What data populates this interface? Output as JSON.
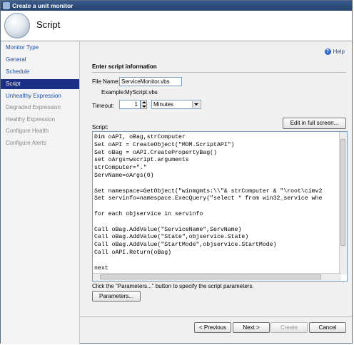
{
  "window": {
    "title": "Create a unit monitor"
  },
  "header": {
    "heading": "Script"
  },
  "sidebar": {
    "items": [
      {
        "label": "Monitor Type",
        "state": "link"
      },
      {
        "label": "General",
        "state": "link"
      },
      {
        "label": "Schedule",
        "state": "link"
      },
      {
        "label": "Script",
        "state": "selected"
      },
      {
        "label": "Unhealthy Expression",
        "state": "link"
      },
      {
        "label": "Degraded Expression",
        "state": "disabled"
      },
      {
        "label": "Healthy Expression",
        "state": "disabled"
      },
      {
        "label": "Configure Health",
        "state": "disabled"
      },
      {
        "label": "Configure Alerts",
        "state": "disabled"
      }
    ]
  },
  "main": {
    "help_label": "Help",
    "section_title": "Enter script information",
    "file_name_label": "File Name:",
    "file_name_value": "ServiceMonitor.vbs",
    "example_label": "Example:",
    "example_value": "MyScript.vbs",
    "timeout_label": "Timeout:",
    "timeout_value": "1",
    "timeout_unit": "Minutes",
    "script_label": "Script:",
    "edit_full_screen": "Edit in full screen...",
    "script_text": "Dim oAPI, oBag,strComputer\nSet oAPI = CreateObject(\"MOM.ScriptAPI\")\nSet oBag = oAPI.CreatePropertyBag()\nset oArgs=wscript.arguments\nstrComputer=\".\"\nServName=oArgs(0)\n\nSet namespace=GetObject(\"winmgmts:\\\\\"& strComputer & \"\\root\\cimv2\nSet servinfo=namespace.ExecQuery(\"select * from win32_service whe\n\nfor each objservice in servinfo\n\nCall oBag.AddValue(\"ServiceName\",ServName)\nCall oBag.AddValue(\"State\",objservice.State)\nCall oBag.AddValue(\"StartMode\",objservice.StartMode)\nCall oAPI.Return(oBag)\n\nnext",
    "params_hint": "Click the \"Parameters...\" button to specify the script parameters.",
    "parameters_button": "Parameters..."
  },
  "footer": {
    "previous": "< Previous",
    "next": "Next >",
    "create": "Create",
    "cancel": "Cancel"
  }
}
